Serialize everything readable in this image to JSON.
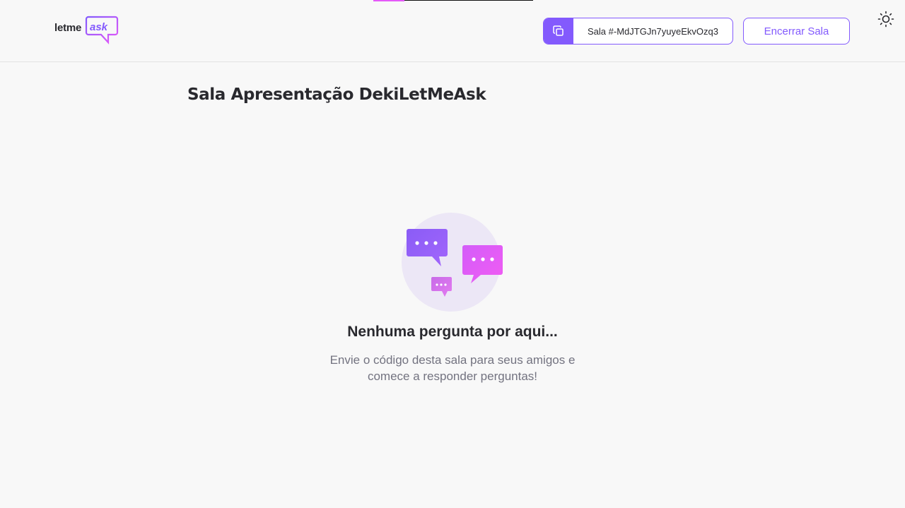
{
  "header": {
    "logo": {
      "part1": "letme",
      "part2": "ask"
    },
    "room_code": {
      "label": "Sala #-MdJTGJn7yuyeEkvOzq3",
      "icon": "copy-icon"
    },
    "end_room_label": "Encerrar Sala",
    "theme_icon": "sun-icon"
  },
  "main": {
    "room_title": "Sala Apresentação DekiLetMeAsk",
    "empty_state": {
      "illustration_icon": "empty-questions-illustration",
      "title": "Nenhuma pergunta por aqui...",
      "description": "Envie o código desta sala para seus amigos e comece a responder perguntas!"
    }
  },
  "colors": {
    "primary": "#835afd",
    "accent_pink": "#e559f9",
    "background": "#f8f8f8",
    "text": "#29292e",
    "muted": "#737380"
  }
}
